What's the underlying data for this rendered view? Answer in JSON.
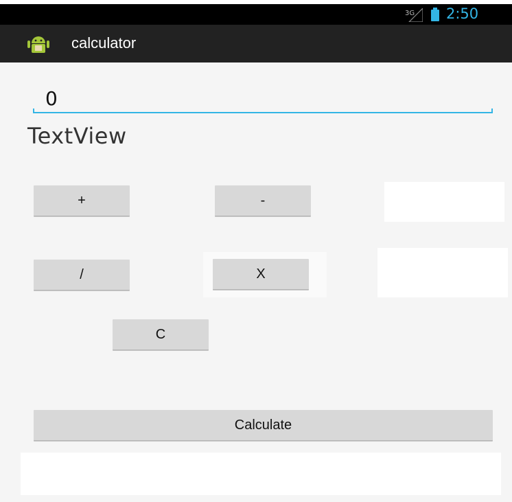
{
  "status_bar": {
    "network_type": "3G",
    "time": "2:50",
    "colors": {
      "accent": "#33b5e5",
      "background": "#000000"
    },
    "icons": [
      "signal-icon",
      "battery-icon"
    ]
  },
  "action_bar": {
    "title": "calculator",
    "icon": "android-app-icon",
    "background": "#222222"
  },
  "main": {
    "number_input": {
      "value": "0"
    },
    "text_view": "TextView",
    "buttons": {
      "plus": "+",
      "minus": "-",
      "divide": "/",
      "multiply": "X",
      "clear": "C",
      "calculate": "Calculate"
    }
  }
}
